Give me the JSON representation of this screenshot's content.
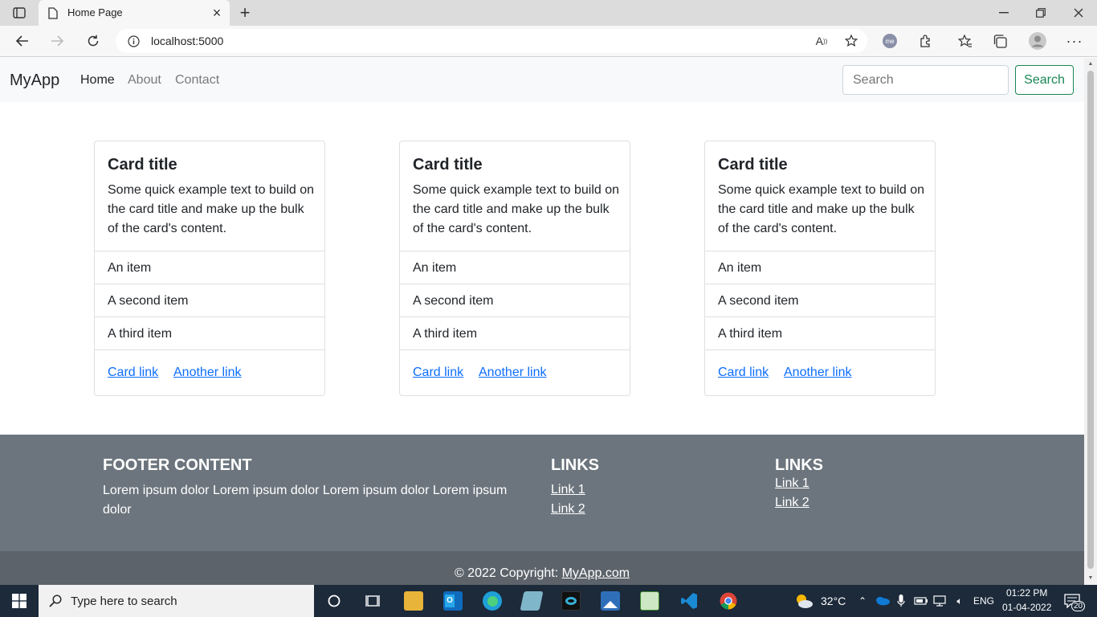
{
  "browser": {
    "tab_title": "Home Page",
    "url": "localhost:5000",
    "new_tab_symbol": "+",
    "close_tab_symbol": "×"
  },
  "navbar": {
    "brand": "MyApp",
    "links": [
      "Home",
      "About",
      "Contact"
    ],
    "search_placeholder": "Search",
    "search_button": "Search"
  },
  "cards": [
    {
      "title": "Card title",
      "text": "Some quick example text to build on the card title and make up the bulk of the card's content.",
      "items": [
        "An item",
        "A second item",
        "A third item"
      ],
      "links": [
        "Card link",
        "Another link"
      ]
    },
    {
      "title": "Card title",
      "text": "Some quick example text to build on the card title and make up the bulk of the card's content.",
      "items": [
        "An item",
        "A second item",
        "A third item"
      ],
      "links": [
        "Card link",
        "Another link"
      ]
    },
    {
      "title": "Card title",
      "text": "Some quick example text to build on the card title and make up the bulk of the card's content.",
      "items": [
        "An item",
        "A second item",
        "A third item"
      ],
      "links": [
        "Card link",
        "Another link"
      ]
    }
  ],
  "footer": {
    "heading": "FOOTER CONTENT",
    "text": "Lorem ipsum dolor Lorem ipsum dolor Lorem ipsum dolor Lorem ipsum dolor",
    "links_col1": {
      "heading": "LINKS",
      "links": [
        "Link 1",
        "Link 2"
      ]
    },
    "links_col2": {
      "heading": "LINKS",
      "links": [
        "Link 1",
        "Link 2"
      ]
    },
    "copyright_prefix": "© 2022 Copyright: ",
    "copyright_link": "MyApp.com"
  },
  "taskbar": {
    "search_placeholder": "Type here to search",
    "weather": "32°C",
    "language": "ENG",
    "time": "01:22 PM",
    "date": "01-04-2022",
    "notification_count": "20"
  },
  "colors": {
    "success": "#198754",
    "link": "#0d6efd",
    "footer_bg": "#6c757d",
    "copyright_bg": "#5c636a",
    "navbar_bg": "#f8f9fa"
  }
}
